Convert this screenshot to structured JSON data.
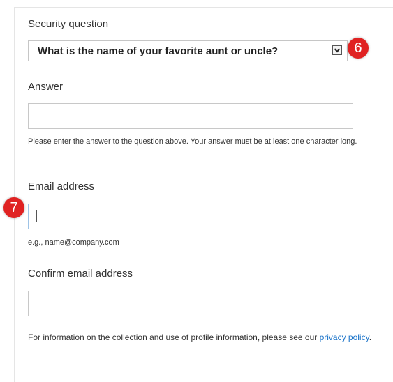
{
  "form": {
    "security_question_label": "Security question",
    "security_question_value": "What is the name of your favorite aunt or uncle?",
    "answer_label": "Answer",
    "answer_value": "",
    "answer_helper": "Please enter the answer to the question above. Your answer must be at least one character long.",
    "email_label": "Email address",
    "email_value": "",
    "email_helper": "e.g., name@company.com",
    "confirm_email_label": "Confirm email address",
    "confirm_email_value": ""
  },
  "footer": {
    "text_before_link": "For information on the collection and use of profile information, please see our ",
    "link_text": "privacy policy",
    "text_after_link": "."
  },
  "markers": {
    "step_6": "6",
    "step_7": "7"
  },
  "colors": {
    "marker": "#e02222",
    "link": "#1a73c9",
    "focus_border": "#9ec3e6"
  },
  "icons": {
    "select_arrow": "chevron-down-icon"
  }
}
